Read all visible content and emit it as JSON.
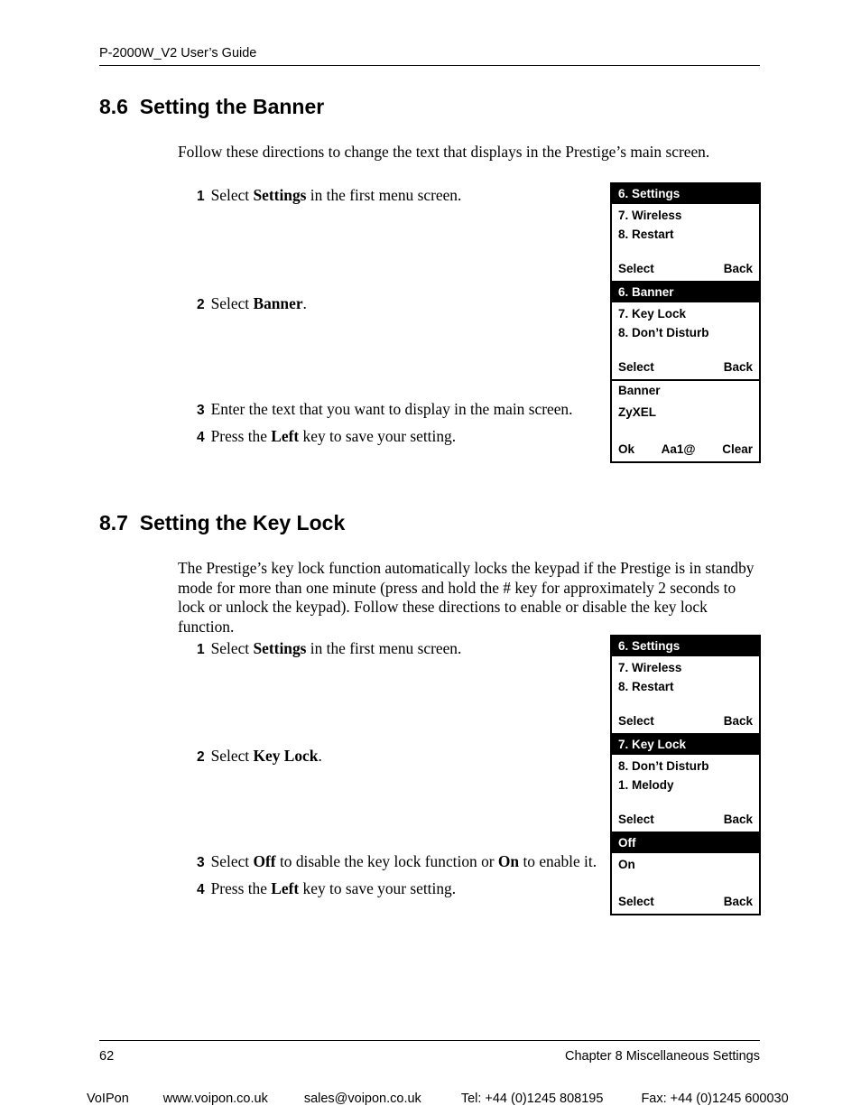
{
  "header": {
    "running_head": "P-2000W_V2 User’s Guide"
  },
  "sections": {
    "banner": {
      "heading": "8.6  Setting the Banner",
      "intro": "Follow these directions to change the text that displays in the Prestige’s main screen.",
      "steps": [
        {
          "num": "1",
          "pre": "Select ",
          "bold": "Settings",
          "post": " in the first menu screen."
        },
        {
          "num": "2",
          "pre": "Select ",
          "bold": "Banner",
          "post": "."
        },
        {
          "num": "3",
          "pre": "Enter the text that you want to display in the main screen.",
          "bold": "",
          "post": ""
        },
        {
          "num": "4",
          "pre": "Press the ",
          "bold": "Left",
          "post": " key to save your setting."
        }
      ],
      "screens": [
        {
          "title": "6. Settings",
          "title_highlighted": true,
          "items": [
            "7. Wireless",
            "8. Restart"
          ],
          "softkeys": {
            "left": "Select",
            "middle": "",
            "right": "Back"
          }
        },
        {
          "title": "6. Banner",
          "title_highlighted": true,
          "items": [
            "7. Key Lock",
            "8. Don’t Disturb"
          ],
          "softkeys": {
            "left": "Select",
            "middle": "",
            "right": "Back"
          }
        },
        {
          "title": "Banner",
          "title_highlighted": false,
          "items": [
            "ZyXEL"
          ],
          "softkeys": {
            "left": "Ok",
            "middle": "Aa1@",
            "right": "Clear"
          }
        }
      ]
    },
    "keylock": {
      "heading": "8.7  Setting the Key Lock",
      "intro": "The Prestige’s key lock function automatically locks the keypad if the Prestige is in standby mode for more than one minute (press and hold the # key for approximately 2 seconds to lock or unlock the keypad).  Follow these directions to enable or disable the key lock function.",
      "steps": [
        {
          "num": "1",
          "pre": "Select ",
          "bold": "Settings",
          "post": " in the first menu screen."
        },
        {
          "num": "2",
          "pre": "Select ",
          "bold": "Key Lock",
          "post": "."
        },
        {
          "num": "3",
          "pre": "Select ",
          "bold": "Off",
          "mid": " to disable the key lock function or ",
          "bold2": "On",
          "post": " to enable it."
        },
        {
          "num": "4",
          "pre": "Press the ",
          "bold": "Left",
          "post": " key to save your setting."
        }
      ],
      "screens": [
        {
          "title": "6. Settings",
          "title_highlighted": true,
          "items": [
            "7. Wireless",
            "8. Restart"
          ],
          "softkeys": {
            "left": "Select",
            "middle": "",
            "right": "Back"
          }
        },
        {
          "title": "7. Key Lock",
          "title_highlighted": true,
          "items": [
            "8. Don’t Disturb",
            "1. Melody"
          ],
          "softkeys": {
            "left": "Select",
            "middle": "",
            "right": "Back"
          }
        },
        {
          "title": "Off",
          "title_highlighted": true,
          "items": [
            "On"
          ],
          "softkeys": {
            "left": "Select",
            "middle": "",
            "right": "Back"
          }
        }
      ]
    }
  },
  "footer": {
    "page_number": "62",
    "chapter": "Chapter 8 Miscellaneous Settings",
    "voipon": {
      "brand": "VoIPon",
      "website": "www.voipon.co.uk",
      "email": "sales@voipon.co.uk",
      "tel": "Tel: +44 (0)1245 808195",
      "fax": "Fax: +44 (0)1245 600030"
    }
  }
}
